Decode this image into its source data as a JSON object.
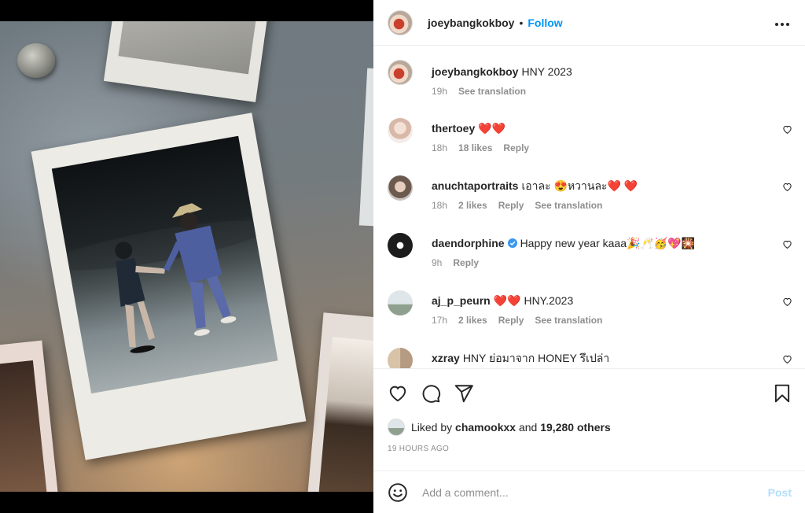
{
  "post": {
    "owner": "joeybangkokboy",
    "separator": "•",
    "follow_label": "Follow",
    "more_label": "•••"
  },
  "caption": {
    "username": "joeybangkokboy",
    "text": "HNY 2023",
    "time": "19h",
    "translate": "See translation"
  },
  "comments": [
    {
      "username": "thertoey",
      "text": "❤️❤️",
      "time": "18h",
      "likes": "18 likes",
      "reply": "Reply",
      "translate": "",
      "verified": false
    },
    {
      "username": "anuchtaportraits",
      "text": "เอาละ 😍หวานละ❤️ ❤️",
      "time": "18h",
      "likes": "2 likes",
      "reply": "Reply",
      "translate": "See translation",
      "verified": false
    },
    {
      "username": "daendorphine",
      "text": "Happy new year kaaa🎉🥂🥳💖🎇",
      "time": "9h",
      "likes": "",
      "reply": "Reply",
      "translate": "",
      "verified": true
    },
    {
      "username": "aj_p_peurn",
      "text": "❤️❤️ HNY.2023",
      "time": "17h",
      "likes": "2 likes",
      "reply": "Reply",
      "translate": "See translation",
      "verified": false
    },
    {
      "username": "xzray",
      "text": "HNY ย่อมาจาก HONEY รึเปล่า",
      "time": "",
      "likes": "",
      "reply": "",
      "translate": "",
      "verified": false
    }
  ],
  "likes_line": {
    "prefix": "Liked by",
    "user": "chamookxx",
    "and": "and",
    "others": "19,280 others"
  },
  "timestamp": "19 HOURS AGO",
  "add_comment": {
    "placeholder": "Add a comment...",
    "post_label": "Post"
  },
  "colors": {
    "link_blue": "#0095f6",
    "post_disabled": "#b2dffc",
    "muted": "#8e8e8e",
    "heart_red": "#ed4956"
  },
  "icons": [
    "heart-icon",
    "comment-icon",
    "share-icon",
    "bookmark-icon",
    "emoji-icon",
    "verified-badge-icon",
    "more-icon"
  ]
}
